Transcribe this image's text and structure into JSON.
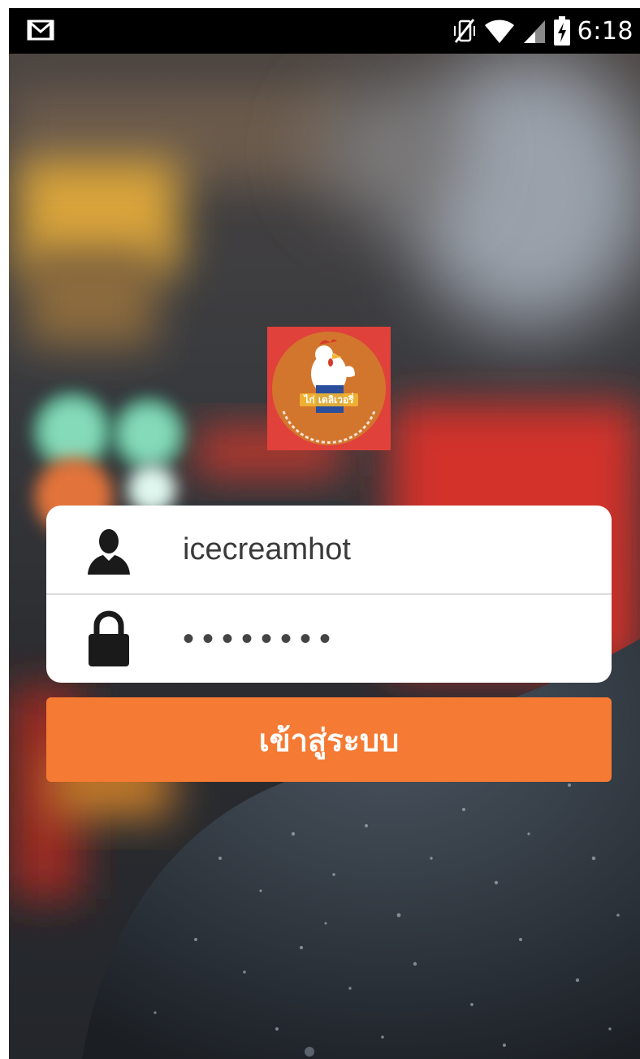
{
  "status_bar": {
    "icons": [
      "gmail-icon",
      "vibrate-off-icon",
      "wifi-icon",
      "signal-icon",
      "battery-charging-icon"
    ],
    "time": "6:18"
  },
  "logo": {
    "icon": "chicken-delivery-logo",
    "text": "ไก่ เดลิเวอรี่",
    "colors": {
      "outer": "#e0413a",
      "circle": "#d3762d"
    }
  },
  "login_form": {
    "username": {
      "icon": "user-icon",
      "value": "icecreamhot"
    },
    "password": {
      "icon": "lock-icon",
      "masked_value": "••••••••"
    }
  },
  "login_button": {
    "label": "เข้าสู่ระบบ"
  },
  "colors": {
    "accent": "#f57a33",
    "card": "#ffffff",
    "status_bar": "#000000"
  }
}
